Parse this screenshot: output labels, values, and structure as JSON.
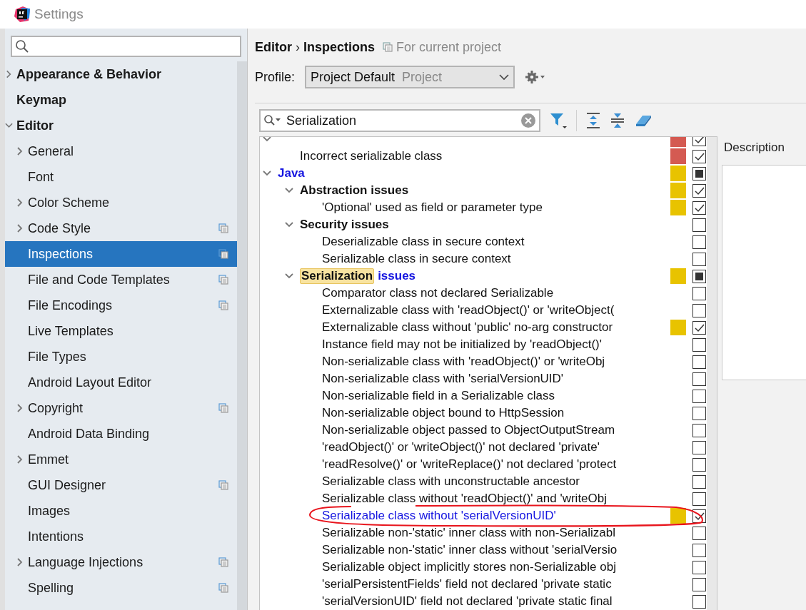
{
  "window": {
    "title": "Settings"
  },
  "sidebar": {
    "items": [
      {
        "label": "Appearance & Behavior",
        "expanded": false,
        "selected": false
      },
      {
        "label": "Keymap",
        "selected": false
      },
      {
        "label": "Editor",
        "expanded": true,
        "selected": false,
        "children": [
          {
            "label": "General",
            "expanded": false,
            "selected": false
          },
          {
            "label": "Font",
            "selected": false
          },
          {
            "label": "Color Scheme",
            "expanded": false,
            "selected": false
          },
          {
            "label": "Code Style",
            "expanded": false,
            "selected": false,
            "project_scope": true
          },
          {
            "label": "Inspections",
            "selected": true,
            "project_scope": true
          },
          {
            "label": "File and Code Templates",
            "selected": false,
            "project_scope": true
          },
          {
            "label": "File Encodings",
            "selected": false,
            "project_scope": true
          },
          {
            "label": "Live Templates",
            "selected": false
          },
          {
            "label": "File Types",
            "selected": false
          },
          {
            "label": "Android Layout Editor",
            "selected": false
          },
          {
            "label": "Copyright",
            "expanded": false,
            "selected": false,
            "project_scope": true
          },
          {
            "label": "Android Data Binding",
            "selected": false
          },
          {
            "label": "Emmet",
            "expanded": false,
            "selected": false
          },
          {
            "label": "GUI Designer",
            "selected": false,
            "project_scope": true
          },
          {
            "label": "Images",
            "selected": false
          },
          {
            "label": "Intentions",
            "selected": false
          },
          {
            "label": "Language Injections",
            "expanded": false,
            "selected": false,
            "project_scope": true
          },
          {
            "label": "Spelling",
            "selected": false,
            "project_scope": true
          }
        ]
      }
    ]
  },
  "breadcrumb": {
    "parent": "Editor",
    "separator": "›",
    "current": "Inspections",
    "scope": "For current project"
  },
  "profile": {
    "label": "Profile:",
    "value": "Project Default",
    "value_kind": "Project"
  },
  "filter": {
    "value": "Serialization"
  },
  "tree": [
    {
      "expanded": true,
      "color": "#d45a52",
      "checked": true,
      "children": [
        {
          "label": "Incorrect serializable class",
          "color": "#d45a52",
          "checked": true
        }
      ]
    },
    {
      "label": "Java",
      "expanded": true,
      "modified": true,
      "color": "#e8c300",
      "checked": true,
      "partial": true,
      "children": [
        {
          "label": "Abstraction issues",
          "expanded": true,
          "color": "#e8c300",
          "checked": true,
          "children": [
            {
              "label": "'Optional' used as field or parameter type",
              "color": "#e8c300",
              "checked": true
            }
          ]
        },
        {
          "label": "Security issues",
          "expanded": true,
          "checked": false,
          "children": [
            {
              "label": "Deserializable class in secure context",
              "checked": false
            },
            {
              "label": "Serializable class in secure context",
              "checked": false
            }
          ]
        },
        {
          "match": "Serialization",
          "label": "issues",
          "expanded": true,
          "modified": true,
          "color": "#e8c300",
          "checked": true,
          "partial": true,
          "children": [
            {
              "label": "Comparator class not declared Serializable",
              "checked": false
            },
            {
              "label": "Externalizable class with 'readObject()' or 'writeObject(",
              "checked": false
            },
            {
              "label": "Externalizable class without 'public' no-arg constructor",
              "color": "#e8c300",
              "checked": true
            },
            {
              "label": "Instance field may not be initialized by 'readObject()'",
              "checked": false
            },
            {
              "label": "Non-serializable class with 'readObject()' or 'writeObj",
              "checked": false
            },
            {
              "label": "Non-serializable class with 'serialVersionUID'",
              "checked": false
            },
            {
              "label": "Non-serializable field in a Serializable class",
              "checked": false
            },
            {
              "label": "Non-serializable object bound to HttpSession",
              "checked": false
            },
            {
              "label": "Non-serializable object passed to ObjectOutputStream",
              "checked": false
            },
            {
              "label": "'readObject()' or 'writeObject()' not declared 'private'",
              "checked": false
            },
            {
              "label": "'readResolve()' or 'writeReplace()' not declared 'protect",
              "checked": false
            },
            {
              "label": "Serializable class with unconstructable ancestor",
              "checked": false
            },
            {
              "label": "Serializable class without 'readObject()' and 'writeObj",
              "checked": false
            },
            {
              "label": "Serializable class without 'serialVersionUID'",
              "modified": true,
              "circled": true,
              "color": "#e8c300",
              "checked": true
            },
            {
              "label": "Serializable non-'static' inner class with non-Serializabl",
              "checked": false
            },
            {
              "label": "Serializable non-'static' inner class without 'serialVersio",
              "checked": false
            },
            {
              "label": "Serializable object implicitly stores non-Serializable obj",
              "checked": false
            },
            {
              "label": "'serialPersistentFields' field not declared 'private static",
              "checked": false
            },
            {
              "label": "'serialVersionUID' field not declared 'private static final",
              "checked": false
            }
          ]
        }
      ]
    }
  ],
  "description": {
    "label": "Description"
  },
  "annotation": {
    "kind": "ellipse",
    "color": "#e8141c"
  }
}
